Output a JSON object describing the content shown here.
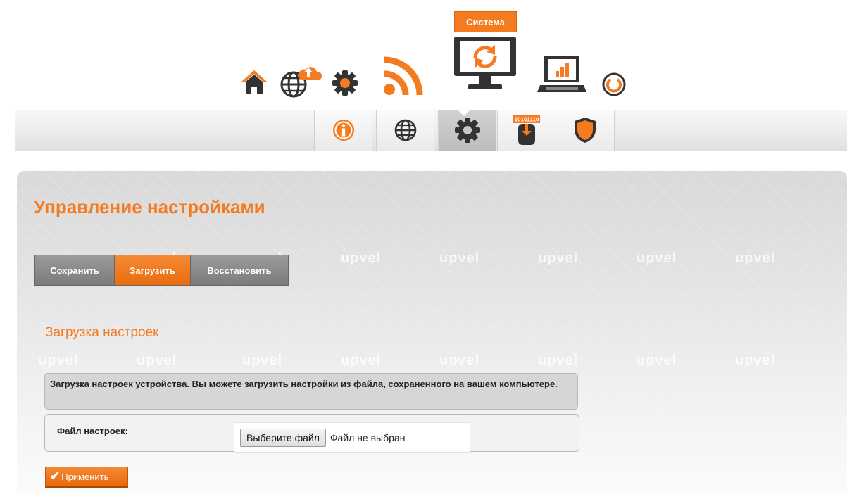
{
  "top_menu": {
    "items": [
      {
        "name": "home",
        "icon": "home-icon"
      },
      {
        "name": "internet",
        "icon": "globe-cloud-icon"
      },
      {
        "name": "settings",
        "icon": "gear-icon"
      },
      {
        "name": "wireless",
        "icon": "wifi-icon"
      },
      {
        "name": "system",
        "icon": "monitor-refresh-icon",
        "label": "Система"
      },
      {
        "name": "status",
        "icon": "laptop-chart-icon"
      },
      {
        "name": "logout",
        "icon": "power-icon"
      }
    ],
    "active_label": "Система"
  },
  "sub_menu": {
    "items": [
      {
        "icon": "info-icon"
      },
      {
        "icon": "globe-icon"
      },
      {
        "icon": "gear-icon",
        "active": true
      },
      {
        "icon": "firmware-upload-icon",
        "badge": "10101110"
      },
      {
        "icon": "shield-icon"
      }
    ]
  },
  "page": {
    "title": "Управление настройками",
    "watermark": "upvel",
    "tabs": [
      {
        "label": "Сохранить",
        "active": false
      },
      {
        "label": "Загрузить",
        "active": true
      },
      {
        "label": "Восстановить",
        "active": false
      }
    ],
    "section_title": "Загрузка настроек",
    "info_text": "Загрузка настроек устройства. Вы можете загрузить настройки из файла, сохраненного на вашем компьютере.",
    "form": {
      "file_label": "Файл настроек:",
      "choose_button": "Выберите файл",
      "file_status": "Файл не выбран"
    },
    "apply_button": "Применить"
  },
  "colors": {
    "accent": "#f47b20",
    "tab_inactive": "#8a8a8a",
    "icon_dark": "#333333",
    "panel": "#e4e4e4"
  }
}
